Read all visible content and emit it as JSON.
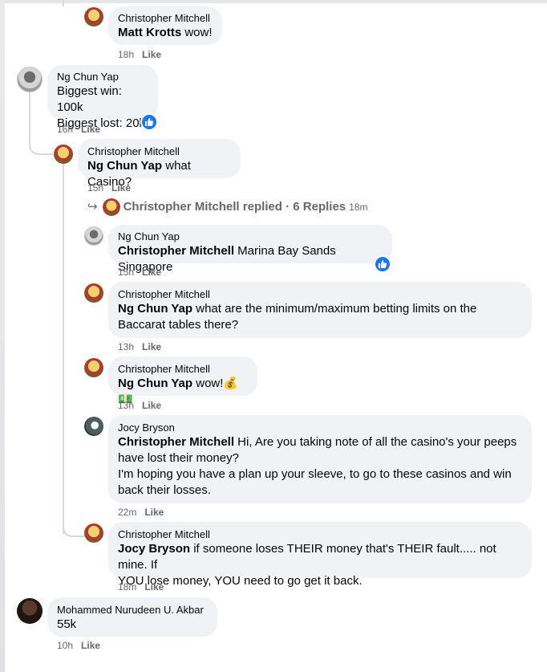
{
  "like_label": "Like",
  "comments": [
    {
      "id": "c1",
      "author": "Christopher Mitchell",
      "mention": "Matt Krotts",
      "text": " wow!",
      "time": "18h"
    },
    {
      "id": "c2",
      "author": "Ng Chun Yap",
      "lines": [
        "Biggest win: 100k",
        "Biggest lost: 20k"
      ],
      "time": "16h",
      "reaction": "like-icon"
    },
    {
      "id": "c3",
      "author": "Christopher Mitchell",
      "mention": "Ng Chun Yap",
      "text": " what Casino?",
      "time": "15h"
    },
    {
      "id": "c4",
      "author": "Ng Chun Yap",
      "mention": "Christopher Mitchell",
      "text": " Marina Bay Sands Singapore",
      "time": "15h",
      "reaction": "like-icon"
    },
    {
      "id": "c5",
      "author": "Christopher Mitchell",
      "mention": "Ng Chun Yap",
      "text": " what are the minimum/maximum betting limits on the",
      "text2": "Baccarat tables there?",
      "time": "13h"
    },
    {
      "id": "c6",
      "author": "Christopher Mitchell",
      "mention": "Ng Chun Yap",
      "text": " wow!💰💵",
      "time": "13h"
    },
    {
      "id": "c7",
      "author": "Jocy Bryson",
      "mention": "Christopher Mitchell",
      "text": " Hi, Are you taking note of all the casino's your peeps",
      "text2": "have lost their money?",
      "text3": "I'm hoping you have a plan up your sleeve, to go to these casinos and win",
      "text4": "back their losses.",
      "time": "22m"
    },
    {
      "id": "c8",
      "author": "Christopher Mitchell",
      "mention": "Jocy Bryson",
      "text": " if someone loses THEIR money that's THEIR fault..... not mine. If",
      "text2": "YOU lose money, YOU need to go get it back.",
      "time": "18m"
    },
    {
      "id": "c9",
      "author": "Mohammed Nurudeen U. Akbar",
      "lines": [
        "55k"
      ],
      "time": "10h"
    }
  ],
  "replies_link": {
    "text": "Christopher Mitchell replied · 6 Replies",
    "time": "18m"
  },
  "colors": {
    "bubble": "#f0f2f5",
    "meta": "#65676b",
    "like_blue": "#1877f2"
  }
}
